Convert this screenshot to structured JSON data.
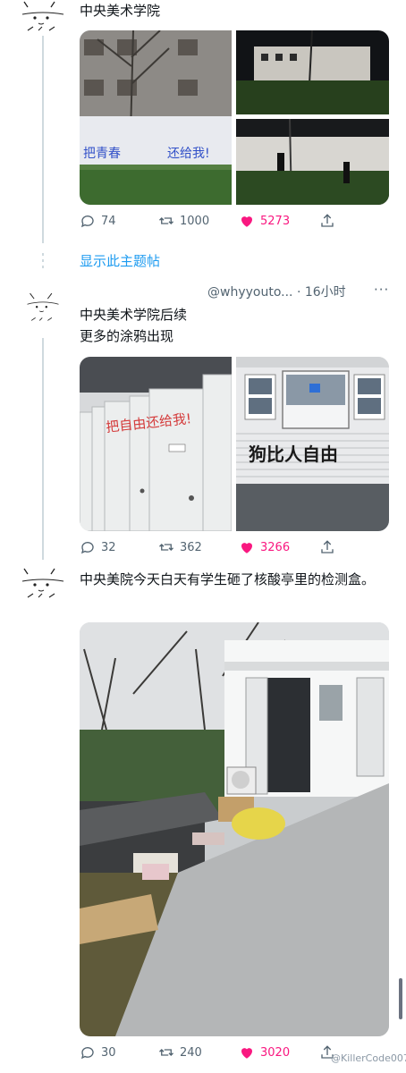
{
  "tweets": [
    {
      "text": "中央美术学院",
      "reply_count": "74",
      "retweet_count": "1000",
      "like_count": "5273",
      "graffiti_1": "把青春",
      "graffiti_2": "还给我!"
    },
    {
      "handle_meta": "@whyyouto... · 16小时",
      "more": "···",
      "text_line1": "中央美术学院后续",
      "text_line2": "更多的涂鸦出现",
      "reply_count": "32",
      "retweet_count": "362",
      "like_count": "3266",
      "graffiti_1": "把自由还给我!",
      "graffiti_2": "狗比人自由"
    },
    {
      "text": "中央美院今天白天有学生砸了核酸亭里的检测盒。",
      "reply_count": "30",
      "retweet_count": "240",
      "like_count": "3020"
    }
  ],
  "thread_link": "显示此主题帖",
  "watermark": "@KillerCode007",
  "colors": {
    "accent": "#1d9bf0",
    "like": "#f91880",
    "muted": "#536471"
  }
}
